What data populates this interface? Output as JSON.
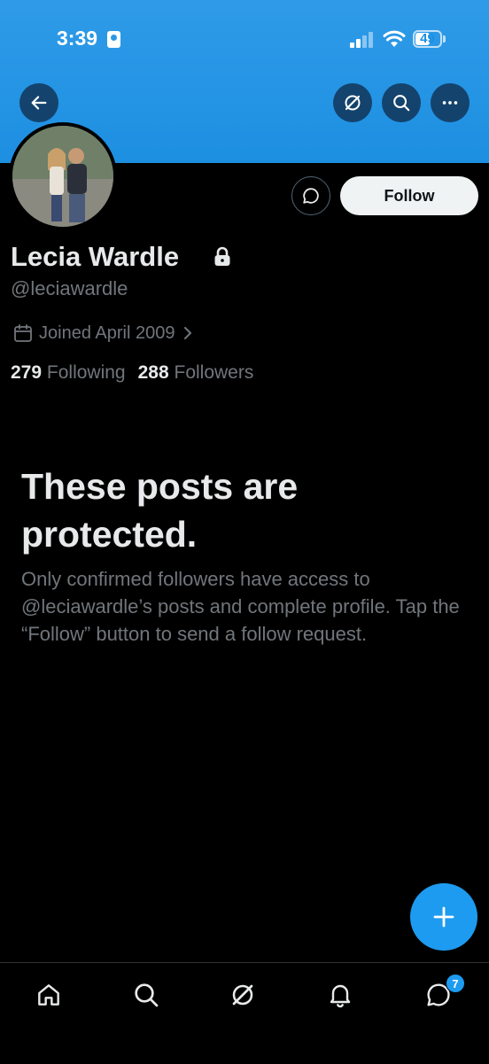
{
  "status_bar": {
    "time": "3:39",
    "battery": "49"
  },
  "profile": {
    "name": "Lecia Wardle",
    "handle": "@leciawardle",
    "joined": "Joined April 2009",
    "following_count": "279",
    "following_label": "Following",
    "followers_count": "288",
    "followers_label": "Followers"
  },
  "actions": {
    "follow_label": "Follow"
  },
  "protected": {
    "title": "These posts are protected.",
    "body": "Only confirmed followers have access to @leciawardle’s posts and complete profile. Tap the “Follow” button to send a follow request."
  },
  "tabbar": {
    "messages_badge": "7"
  },
  "icons": {
    "back": "arrow-left-icon",
    "grok": "grok-icon",
    "search": "search-icon",
    "more": "more-icon",
    "message": "message-icon",
    "compose": "plus-icon"
  },
  "colors": {
    "accent": "#1d9bf0",
    "banner": "#1d8fe1",
    "background": "#000000"
  }
}
